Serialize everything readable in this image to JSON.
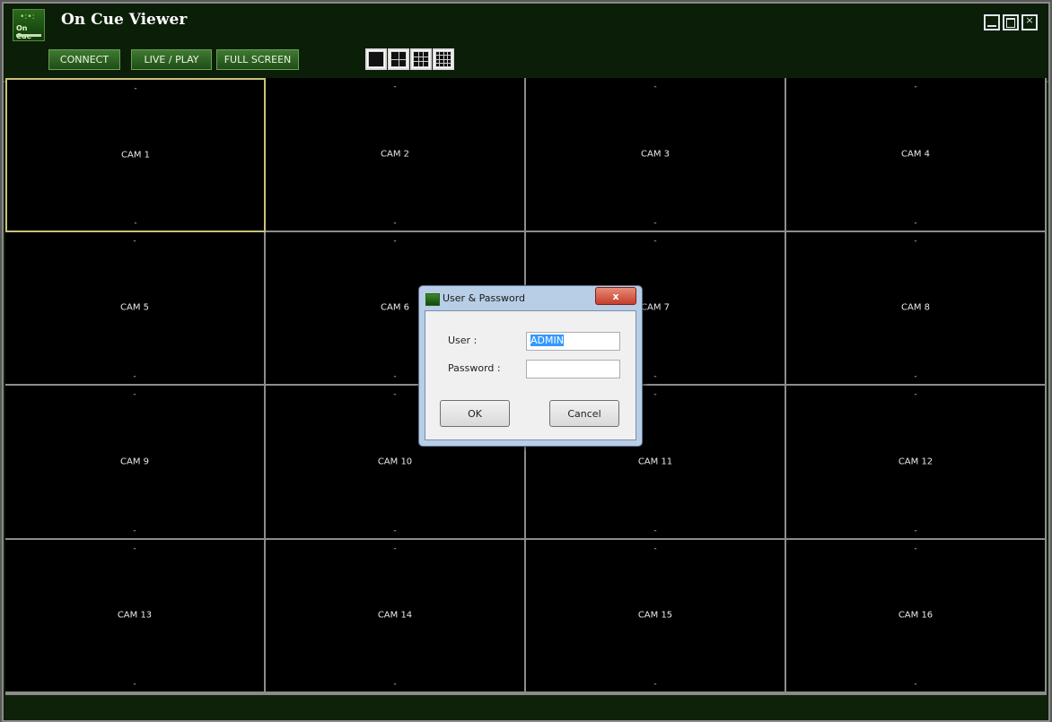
{
  "app": {
    "title": "On Cue Viewer",
    "logo_text": "On Cue"
  },
  "toolbar": {
    "connect_label": "CONNECT",
    "live_play_label": "LIVE / PLAY",
    "full_screen_label": "FULL SCREEN"
  },
  "layout_buttons": [
    "1x1-layout-icon",
    "2x2-layout-icon",
    "3x3-layout-icon",
    "4x4-layout-icon"
  ],
  "window_buttons": [
    "minimize-icon",
    "maximize-icon",
    "close-icon"
  ],
  "cameras": [
    "CAM 1",
    "CAM 2",
    "CAM 3",
    "CAM 4",
    "CAM 5",
    "CAM 6",
    "CAM 7",
    "CAM 8",
    "CAM 9",
    "CAM 10",
    "CAM 11",
    "CAM 12",
    "CAM 13",
    "CAM 14",
    "CAM 15",
    "CAM 16"
  ],
  "camera_placeholder": "-",
  "dialog": {
    "title": "User & Password",
    "close_glyph": "x",
    "user_label": "User :",
    "user_value": "ADMIN",
    "password_label": "Password :",
    "password_value": "",
    "ok_label": "OK",
    "cancel_label": "Cancel"
  },
  "colors": {
    "app_bg": "#0d1f08",
    "button_green": "#2f6425",
    "selected_border": "#c9c27a",
    "dialog_frame": "#b8cde6"
  }
}
